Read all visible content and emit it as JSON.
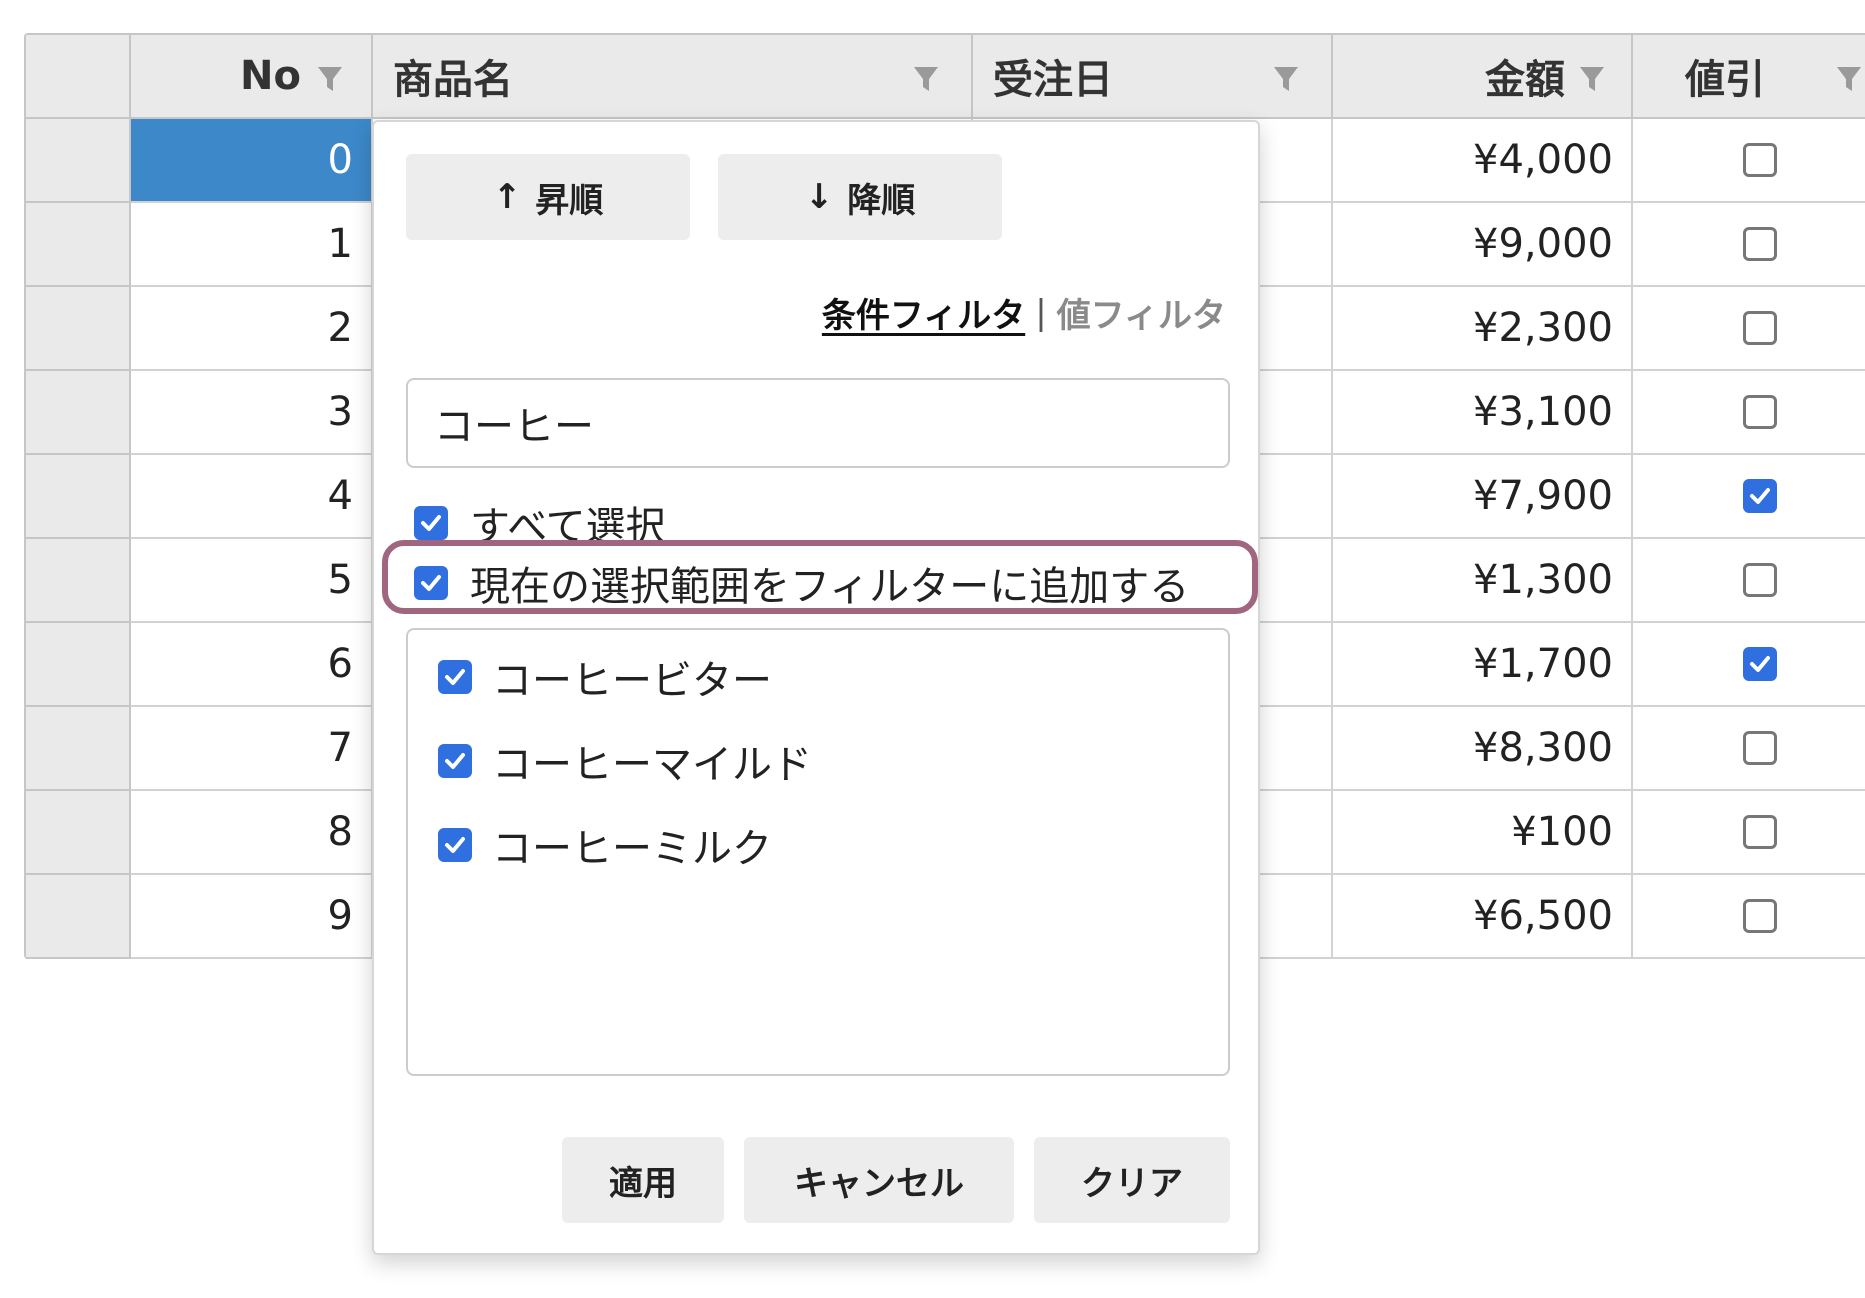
{
  "grid": {
    "columns": [
      {
        "key": "no",
        "label": "No",
        "align": "right"
      },
      {
        "key": "name",
        "label": "商品名",
        "align": "left"
      },
      {
        "key": "date",
        "label": "受注日",
        "align": "left"
      },
      {
        "key": "amount",
        "label": "金額",
        "align": "right"
      },
      {
        "key": "discount",
        "label": "値引",
        "align": "left"
      }
    ],
    "rows": [
      {
        "no": "0",
        "amount": "¥4,000",
        "discount": false,
        "selected": true
      },
      {
        "no": "1",
        "amount": "¥9,000",
        "discount": false
      },
      {
        "no": "2",
        "amount": "¥2,300",
        "discount": false
      },
      {
        "no": "3",
        "amount": "¥3,100",
        "discount": false
      },
      {
        "no": "4",
        "amount": "¥7,900",
        "discount": true
      },
      {
        "no": "5",
        "amount": "¥1,300",
        "discount": false
      },
      {
        "no": "6",
        "amount": "¥1,700",
        "discount": true
      },
      {
        "no": "7",
        "amount": "¥8,300",
        "discount": false
      },
      {
        "no": "8",
        "amount": "¥100",
        "discount": false
      },
      {
        "no": "9",
        "amount": "¥6,500",
        "discount": false
      }
    ]
  },
  "filter_popup": {
    "sort_asc_label": "昇順",
    "sort_asc_arrow": "↑",
    "sort_desc_label": "降順",
    "sort_desc_arrow": "↓",
    "tab_condition": "条件フィルタ",
    "tab_separator": "|",
    "tab_value": "値フィルタ",
    "search_value": "コーヒー",
    "select_all_label": "すべて選択",
    "select_all_checked": true,
    "add_current_label": "現在の選択範囲をフィルターに追加する",
    "add_current_checked": true,
    "values": [
      {
        "label": "コーヒービター",
        "checked": true
      },
      {
        "label": "コーヒーマイルド",
        "checked": true
      },
      {
        "label": "コーヒーミルク",
        "checked": true
      }
    ],
    "apply_label": "適用",
    "cancel_label": "キャンセル",
    "clear_label": "クリア"
  },
  "colors": {
    "selected_cell": "#3c88c9",
    "checkbox_checked": "#2f6fe0",
    "highlight_ring": "#a06680",
    "header_bg": "#eaeaea"
  },
  "icons": {
    "column_filter": "filter-funnel-icon",
    "checkbox": "checkmark-icon"
  }
}
